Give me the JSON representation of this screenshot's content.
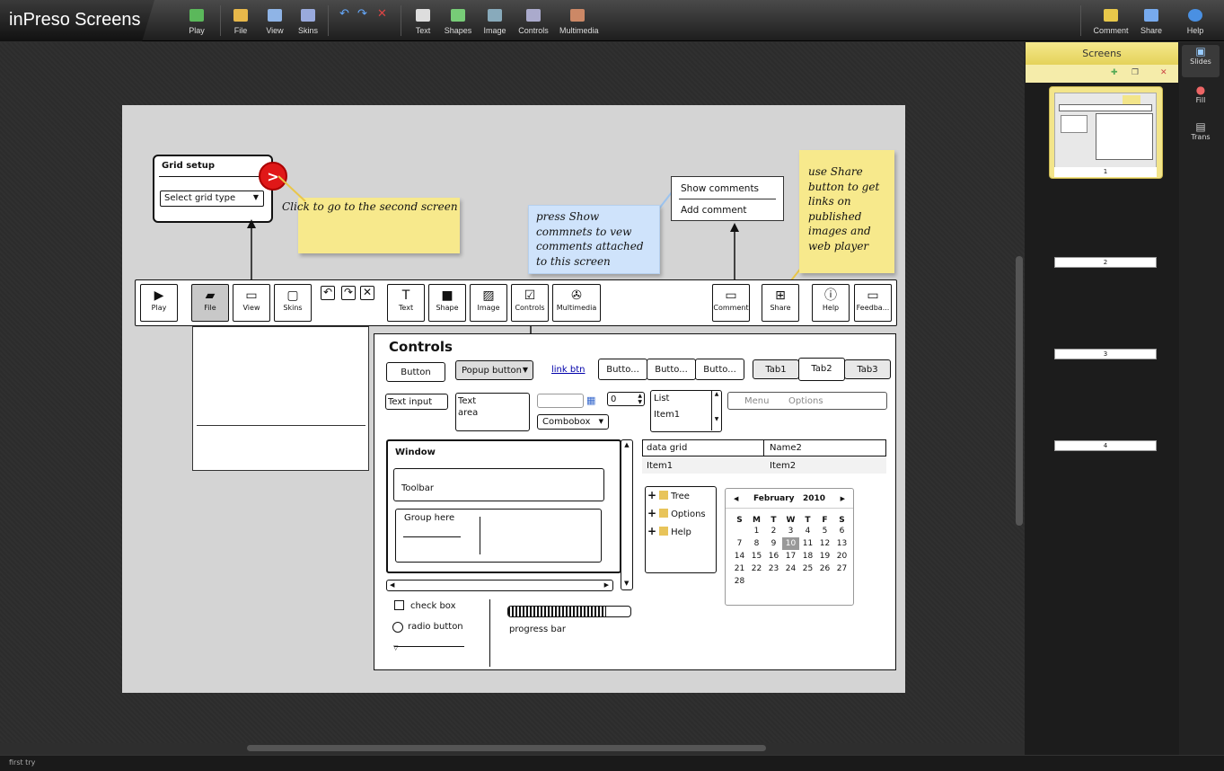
{
  "app": {
    "logo": "inPreso",
    "name": "Screens"
  },
  "toolbar": {
    "buttons": [
      {
        "label": "Play",
        "icon": "play-icon"
      },
      {
        "label": "File",
        "icon": "folder-icon"
      },
      {
        "label": "View",
        "icon": "view-icon"
      },
      {
        "label": "Skins",
        "icon": "skins-icon"
      },
      {
        "label": "Text",
        "icon": "text-icon"
      },
      {
        "label": "Shapes",
        "icon": "shapes-icon"
      },
      {
        "label": "Image",
        "icon": "image-icon"
      },
      {
        "label": "Controls",
        "icon": "controls-icon"
      },
      {
        "label": "Multimedia",
        "icon": "multimedia-icon"
      },
      {
        "label": "Comment",
        "icon": "comment-icon"
      },
      {
        "label": "Share",
        "icon": "share-icon"
      },
      {
        "label": "Help",
        "icon": "help-icon"
      }
    ]
  },
  "canvas": {
    "grid_setup": {
      "title": "Grid setup",
      "select": "Select grid type"
    },
    "notes": {
      "click_note": "Click to go to the second screen",
      "comments_note": "press Show commnets to vew comments attached to this screen",
      "share_note": "use Share button to get links on published images and web player"
    },
    "comment_menu": {
      "show": "Show comments",
      "add": "Add comment"
    },
    "mock_toolbar": [
      "Play",
      "File",
      "View",
      "Skins",
      "Text",
      "Shape",
      "Image",
      "Controls",
      "Multimedia",
      "Comment",
      "Share",
      "Help",
      "Feedba..."
    ],
    "controls": {
      "title": "Controls",
      "button": "Button",
      "popup": "Popup button",
      "link": "link btn",
      "seg": [
        "Butto...",
        "Butto...",
        "Butto..."
      ],
      "tabs": [
        "Tab1",
        "Tab2",
        "Tab3"
      ],
      "text_input": "Text input",
      "text_area": "Text\narea",
      "stepper_value": "0",
      "combobox": "Combobox",
      "list": [
        "List",
        "Item1"
      ],
      "menu": [
        "Menu",
        "Options"
      ],
      "window": {
        "title": "Window",
        "toolbar": "Toolbar",
        "group": "Group here"
      },
      "grid": {
        "headers": [
          "data grid",
          "Name2"
        ],
        "row": [
          "Item1",
          "Item2"
        ]
      },
      "tree": [
        "Tree",
        "Options",
        "Help"
      ],
      "calendar": {
        "month": "February",
        "year": "2010",
        "days": [
          "S",
          "M",
          "T",
          "W",
          "T",
          "F",
          "S"
        ],
        "weeks": [
          [
            "",
            "1",
            "2",
            "3",
            "4",
            "5",
            "6"
          ],
          [
            "7",
            "8",
            "9",
            "10",
            "11",
            "12",
            "13"
          ],
          [
            "14",
            "15",
            "16",
            "17",
            "18",
            "19",
            "20"
          ],
          [
            "21",
            "22",
            "23",
            "24",
            "25",
            "26",
            "27"
          ],
          [
            "28",
            "",
            "",
            "",
            "",
            "",
            ""
          ]
        ],
        "selected": "10"
      },
      "checkbox": "check box",
      "radio": "radio button",
      "progress_label": "progress bar"
    }
  },
  "screens_panel": {
    "title": "Screens",
    "slides": [
      "1",
      "2",
      "3",
      "4"
    ]
  },
  "side_tabs": [
    "Slides",
    "Fill",
    "Trans"
  ],
  "status": "first try"
}
